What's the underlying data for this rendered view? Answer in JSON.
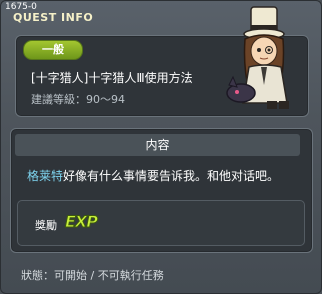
{
  "window": {
    "quest_id": "1675-0",
    "title": "QUEST INFO"
  },
  "quest": {
    "category_badge": "一般",
    "name": "[十字猎人]十字猎人Ⅲ使用方法",
    "level": "建議等級：90～94"
  },
  "content": {
    "header": "内容",
    "npc_name": "格莱特",
    "dialogue": "好像有什么事情要告诉我。和他对话吧。"
  },
  "reward": {
    "label": "獎勵",
    "icon": "exp-icon",
    "icon_text": "EXP"
  },
  "status": {
    "text": "狀態：可開始 / 不可執行任務"
  },
  "colors": {
    "badge": "#8db526",
    "npc_name": "#7ed4ef",
    "exp": "#c9f03b",
    "title": "#f5f0c8"
  }
}
